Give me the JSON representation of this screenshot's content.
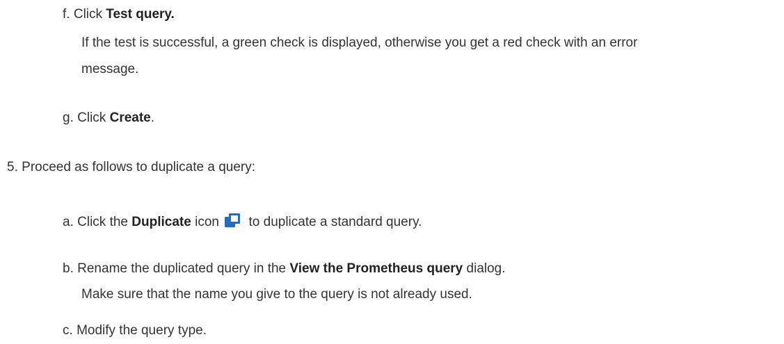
{
  "steps": {
    "f": {
      "marker": "f.",
      "prefix": "Click ",
      "bold": "Test query.",
      "note_line1": "If the test is successful, a green check is displayed, otherwise you get a red check with an error",
      "note_line2": "message."
    },
    "g": {
      "marker": "g.",
      "prefix": "Click ",
      "bold": "Create",
      "suffix": "."
    },
    "five": {
      "marker": "5.",
      "text": "Proceed as follows to duplicate a query:"
    },
    "a": {
      "marker": "a.",
      "prefix": "Click the ",
      "bold": "Duplicate",
      "middle": " icon",
      "icon": "duplicate-icon",
      "suffix": " to duplicate a standard query."
    },
    "b": {
      "marker": "b.",
      "prefix": "Rename the duplicated query in the ",
      "bold": "View the Prometheus query",
      "suffix": " dialog.",
      "note": "Make sure that the name you give to the query is not already used."
    },
    "c": {
      "marker": "c.",
      "text": "Modify the query type."
    }
  },
  "colors": {
    "icon_fill": "#1f70c1",
    "text": "#333333"
  }
}
